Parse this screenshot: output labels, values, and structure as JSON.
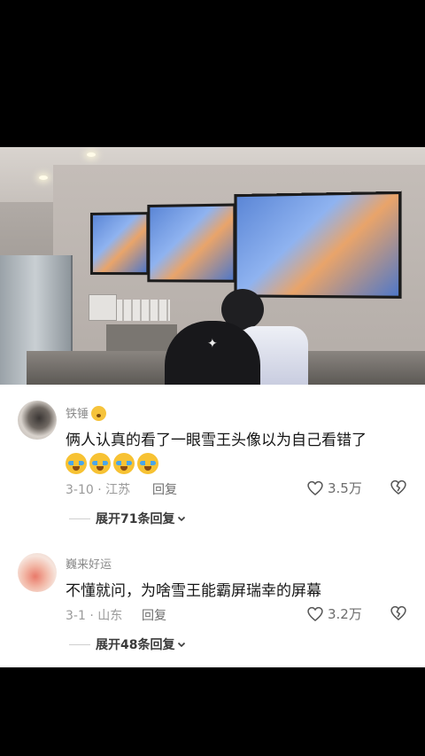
{
  "comments": [
    {
      "username": "铁锤",
      "text": "俩人认真的看了一眼雪王头像以为自己看错了",
      "date_location": "3-10 · 江苏",
      "reply_label": "回复",
      "likes": "3.5万",
      "expand_label": "展开71条回复",
      "has_badge": true,
      "emoji_count": 4
    },
    {
      "username": "巍来好运",
      "text": "不懂就问，为啥雪王能霸屏瑞幸的屏幕",
      "date_location": "3-1 · 山东",
      "reply_label": "回复",
      "likes": "3.2万",
      "expand_label": "展开48条回复",
      "has_badge": false,
      "emoji_count": 0
    }
  ],
  "colors": {
    "background": "#000000",
    "panel": "#ffffff",
    "text_primary": "#161616",
    "text_secondary": "#9a9a9a"
  }
}
